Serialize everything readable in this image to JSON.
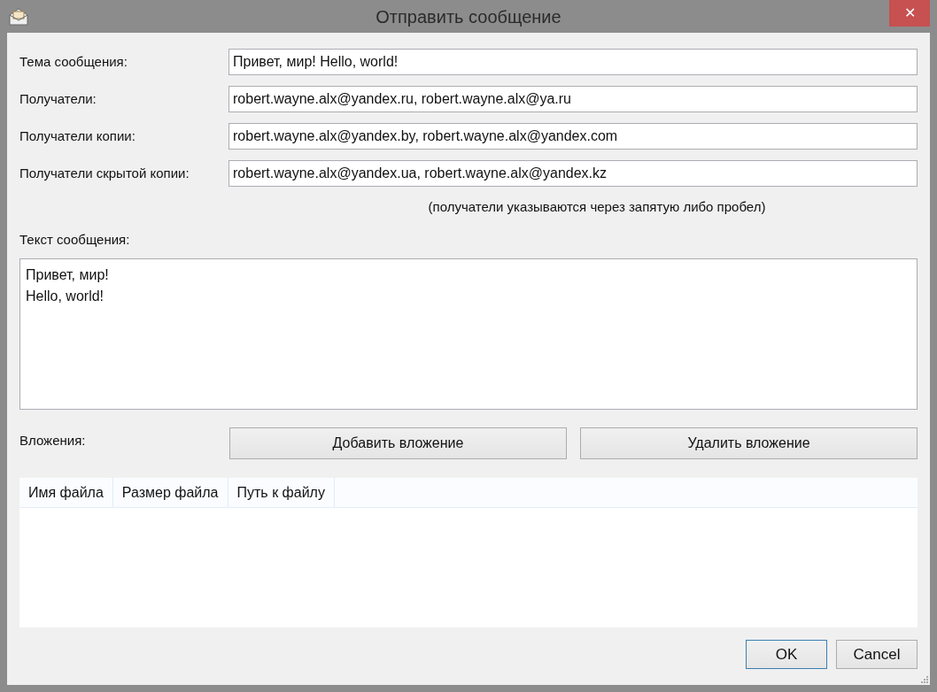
{
  "window": {
    "title": "Отправить сообщение",
    "close": "✕"
  },
  "fields": [
    {
      "label": "Тема сообщения:",
      "value": "Привет, мир! Hello, world!"
    },
    {
      "label": "Получатели:",
      "value": "robert.wayne.alx@yandex.ru, robert.wayne.alx@ya.ru"
    },
    {
      "label": "Получатели копии:",
      "value": "robert.wayne.alx@yandex.by, robert.wayne.alx@yandex.com"
    },
    {
      "label": "Получатели скрытой копии:",
      "value": "robert.wayne.alx@yandex.ua, robert.wayne.alx@yandex.kz"
    }
  ],
  "hint": "(получатели указываются через запятую либо пробел)",
  "message": {
    "label": "Текст сообщения:",
    "value": "Привет, мир!\nHello, world!"
  },
  "attachments": {
    "label": "Вложения:",
    "buttons": [
      "Добавить вложение",
      "Удалить вложение"
    ],
    "columns": [
      "Имя файла",
      "Размер файла",
      "Путь к файлу"
    ]
  },
  "buttons": [
    {
      "label": "OK",
      "default": true
    },
    {
      "label": "Cancel",
      "default": false
    }
  ]
}
